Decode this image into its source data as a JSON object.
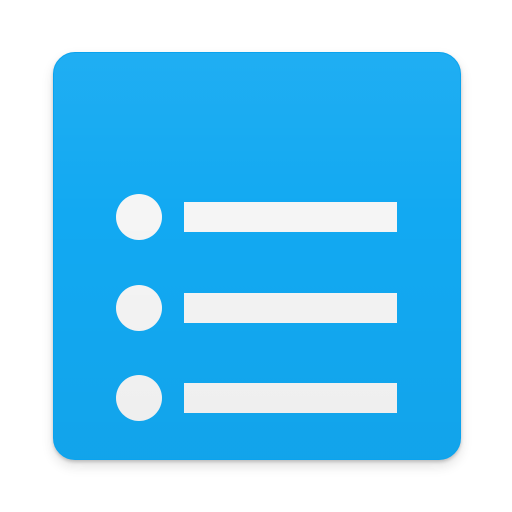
{
  "icon": {
    "name": "list-icon",
    "colors": {
      "tile": "#12A9F2",
      "tile_edge": "#0AA3EF",
      "glyph": "#F5F5F5"
    },
    "rows": [
      {
        "bullet": "bullet-dot",
        "line": "list-line"
      },
      {
        "bullet": "bullet-dot",
        "line": "list-line"
      },
      {
        "bullet": "bullet-dot",
        "line": "list-line"
      }
    ]
  }
}
